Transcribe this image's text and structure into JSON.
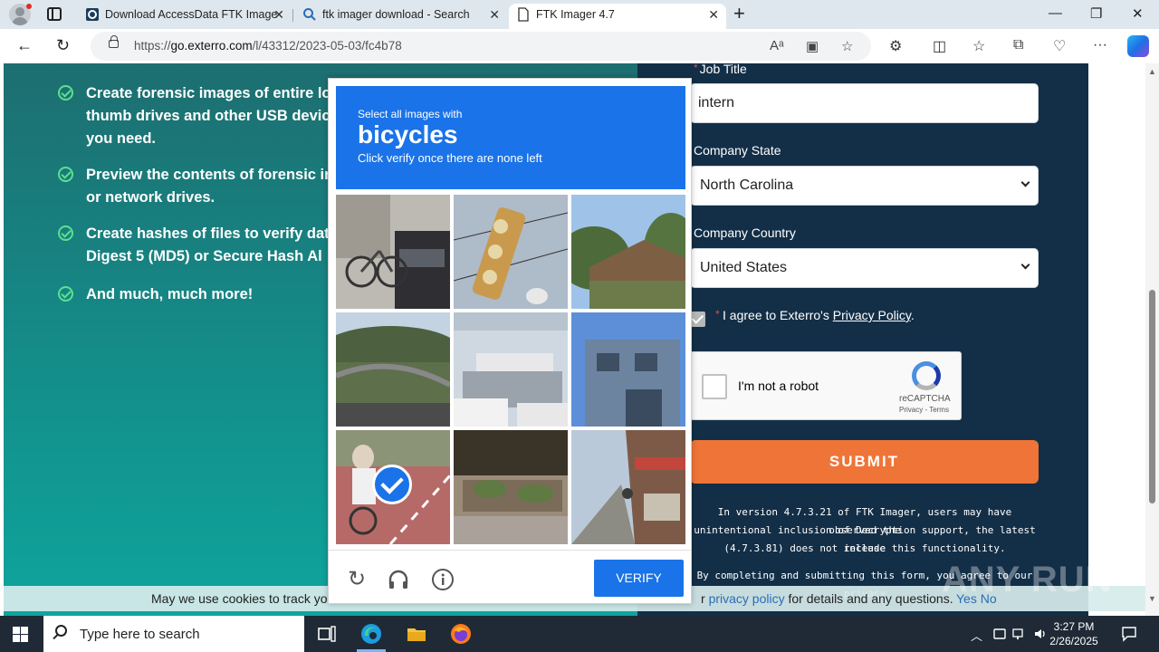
{
  "browser": {
    "tabs": [
      {
        "title": "Download AccessData FTK Image",
        "active": false
      },
      {
        "title": "ftk imager download - Search",
        "active": false
      },
      {
        "title": "FTK Imager 4.7",
        "active": true
      }
    ],
    "url_prefix": "https://",
    "url_domain": "go.exterro.com",
    "url_path": "/l/43312/2023-05-03/fc4b78"
  },
  "page": {
    "benefits": [
      {
        "text": "Create forensic images of entire lo",
        "text2": "thumb drives and other USB devic",
        "text3": "you need."
      },
      {
        "text": "Preview the contents of forensic in",
        "text2": "or network drives."
      },
      {
        "text": "Create hashes of files to verify dat",
        "text2": "Digest 5 (MD5) or Secure Hash Al"
      },
      {
        "text": "And much, much more!"
      }
    ],
    "form": {
      "job_title_label": "Job Title",
      "job_title_value": "intern",
      "state_label": "Company State",
      "state_value": "North Carolina",
      "country_label": "Company Country",
      "country_value": "United States",
      "agree_prefix": "I agree to Exterro's ",
      "agree_link": "Privacy Policy",
      "agree_suffix": ".",
      "recaptcha_label": "I'm not a robot",
      "recaptcha_brand": "reCAPTCHA",
      "recaptcha_terms": "Privacy - Terms",
      "submit_label": "SUBMIT",
      "note1": "In version 4.7.3.21 of FTK Imager, users may have observed the",
      "note2": "unintentional inclusion of Decryption support, the latest release",
      "note3": "(4.7.3.81) does not include this functionality.",
      "note4": "By completing and submitting this form, you agree to our privacy"
    },
    "cookie": {
      "left_text": "May we use cookies to track yo",
      "right_prefix": "r ",
      "right_link": "privacy policy",
      "right_suffix": " for details and any questions.",
      "yes": "Yes",
      "no": "No"
    },
    "watermark": "ANY RUN"
  },
  "captcha": {
    "line1": "Select all images with",
    "target": "bicycles",
    "line3": "Click verify once there are none left",
    "tiles": [
      {
        "desc": "bicycle parked by car",
        "selected": false
      },
      {
        "desc": "traffic light",
        "selected": false
      },
      {
        "desc": "wooden house with trees",
        "selected": false
      },
      {
        "desc": "bridge over river",
        "selected": false
      },
      {
        "desc": "street with cars and sign",
        "selected": false
      },
      {
        "desc": "building facade",
        "selected": false
      },
      {
        "desc": "person riding bicycle",
        "selected": true
      },
      {
        "desc": "planters by building",
        "selected": false
      },
      {
        "desc": "sidewalk cafe",
        "selected": false
      }
    ],
    "verify_label": "VERIFY"
  },
  "taskbar": {
    "search_placeholder": "Type here to search",
    "time": "3:27 PM",
    "date": "2/26/2025"
  }
}
